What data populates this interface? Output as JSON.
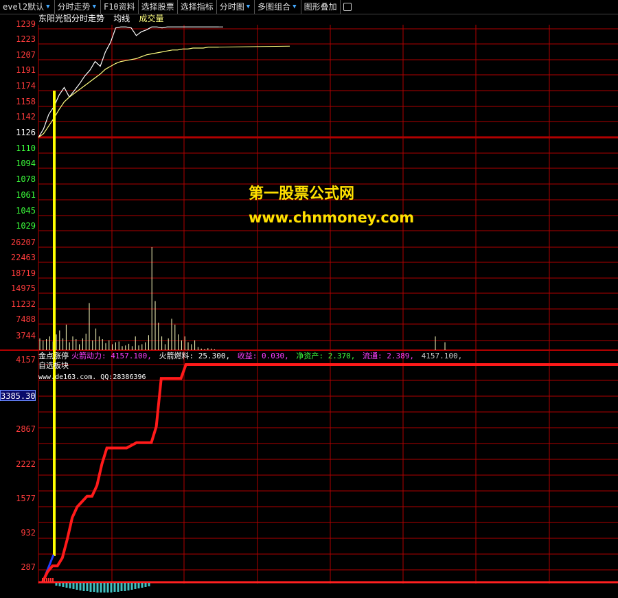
{
  "toolbar": {
    "items": [
      {
        "label": "evel2默认",
        "arrow": true
      },
      {
        "label": "分时走势",
        "arrow": true
      },
      {
        "label": "F10资料",
        "arrow": false
      },
      {
        "label": "选择股票",
        "arrow": false
      },
      {
        "label": "选择指标",
        "arrow": false
      },
      {
        "label": "分时图",
        "arrow": true
      },
      {
        "label": "多图组合",
        "arrow": true
      },
      {
        "label": "图形叠加",
        "arrow": false
      }
    ]
  },
  "price_panel": {
    "title": "东阳光铝分时走势",
    "legend_avg": "均线",
    "legend_vol": "成交量",
    "price_ticks": [
      "1239",
      "1223",
      "1207",
      "1191",
      "1174",
      "1158",
      "1142",
      "1126",
      "1110",
      "1094",
      "1078",
      "1061",
      "1045",
      "1029"
    ],
    "volume_ticks": [
      "26207",
      "22463",
      "18719",
      "14975",
      "11232",
      "7488",
      "3744"
    ]
  },
  "watermark": {
    "line1": "第一股票公式网",
    "line2": "www.chnmoney.com"
  },
  "indicator": {
    "name": "金点涨停",
    "rocket_power_label": "火箭动力:",
    "rocket_power_value": "4157.100,",
    "rocket_fuel_label": "火箭燃料:",
    "rocket_fuel_value": "25.300,",
    "earnings_label": "收益:",
    "earnings_value": "0.030,",
    "net_assets_label": "净资产:",
    "net_assets_value": "2.370,",
    "float_label": "流通:",
    "float_value": "2.389,",
    "last_value": "4157.100,",
    "sub_title": "自选板块",
    "site": "www.de163.com.   QQ:28386396",
    "cursor_value": "3385.30",
    "ticks": [
      "4157",
      "2867",
      "2222",
      "1577",
      "932",
      "287"
    ]
  },
  "colors": {
    "grid": "#b00000",
    "price_line": "#ffffff",
    "avg_line": "#ffff80",
    "indicator_line": "#ff1a1a",
    "yellow_bar": "#ffff00",
    "blue_line": "#2040ff",
    "cyan_bars": "#40c0c0"
  },
  "chart_data": [
    {
      "type": "line",
      "title": "东阳光铝分时走势",
      "series": [
        {
          "name": "分时走势",
          "values": [
            1126,
            1135,
            1150,
            1158,
            1170,
            1178,
            1168,
            1175,
            1182,
            1190,
            1196,
            1205,
            1200,
            1215,
            1225,
            1240,
            1244,
            1243,
            1240,
            1232,
            1236,
            1238,
            1242,
            1241,
            1240,
            1242,
            1243,
            1244,
            1244,
            1243,
            1244,
            1244,
            1243,
            1244,
            1244,
            1244
          ]
        },
        {
          "name": "均线",
          "values": [
            1126,
            1130,
            1138,
            1146,
            1155,
            1163,
            1168,
            1172,
            1176,
            1180,
            1184,
            1188,
            1192,
            1197,
            1200,
            1203,
            1205,
            1206,
            1207,
            1208,
            1210,
            1212,
            1213,
            1214,
            1215,
            1216,
            1217,
            1217,
            1218,
            1218,
            1219,
            1219,
            1219,
            1220,
            1220,
            1220
          ]
        }
      ],
      "ylim": [
        1029,
        1239
      ]
    },
    {
      "type": "bar",
      "title": "成交量",
      "values": [
        3000,
        2500,
        2800,
        3500,
        2200,
        4000,
        5000,
        3000,
        6500,
        2000,
        3500,
        2800,
        1500,
        3000,
        4200,
        12000,
        2500,
        5500,
        3500,
        2800,
        1800,
        2500,
        1500,
        2000,
        2200,
        1000,
        1200,
        1600,
        1000,
        3500,
        1200,
        1500,
        2000,
        3800,
        26207,
        12500,
        7000,
        3500,
        1500,
        3000,
        8000,
        6500,
        4000,
        2500,
        3500,
        2000,
        1500,
        2500,
        800,
        400,
        300,
        500,
        400,
        200,
        3500,
        2000
      ],
      "ylim": [
        0,
        26207
      ]
    },
    {
      "type": "line",
      "title": "金点涨停",
      "series": [
        {
          "name": "火箭动力",
          "values": [
            100,
            287,
            400,
            400,
            550,
            900,
            1300,
            1500,
            1600,
            1700,
            1700,
            1900,
            2300,
            2600,
            2600,
            2600,
            2600,
            2600,
            2650,
            2700,
            2700,
            2700,
            2700,
            3000,
            3900,
            3900,
            3900,
            3900,
            3900,
            4157,
            4157,
            4157,
            4157,
            4157,
            4157,
            4157
          ]
        }
      ],
      "ylim": [
        287,
        4157
      ]
    }
  ]
}
